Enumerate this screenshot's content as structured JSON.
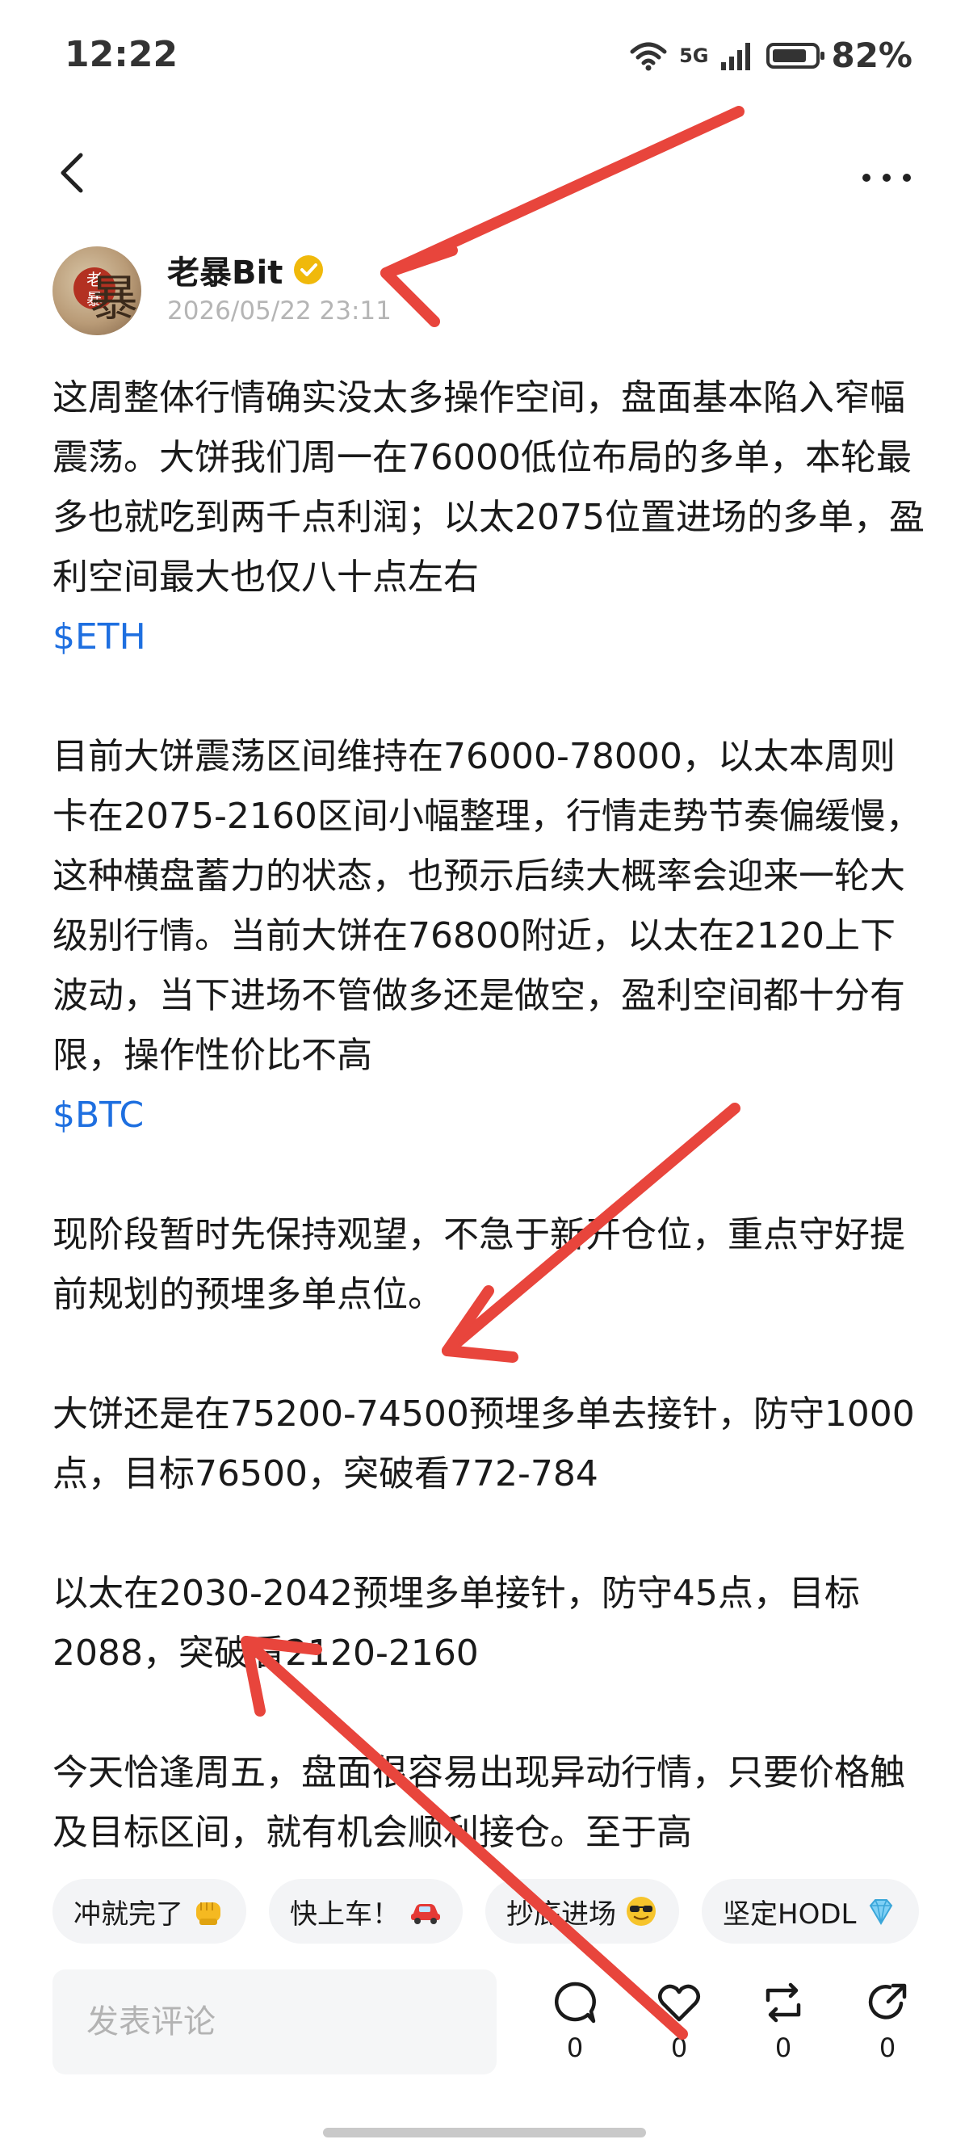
{
  "status_bar": {
    "time": "12:22",
    "network": "5G",
    "battery": "82%",
    "battery_level": 0.82
  },
  "nav": {
    "back_icon": "chevron-left-icon",
    "more_icon": "more-icon"
  },
  "author": {
    "name": "老暴Bit",
    "timestamp": "2026/05/22 23:11",
    "verified_color": "#f0b90b"
  },
  "post": {
    "paragraphs": [
      {
        "text": "这周整体行情确实没太多操作空间，盘面基本陷入窄幅震荡。大饼我们周一在76000低位布局的多单，本轮最多也就吃到两千点利润；以太2075位置进场的多单，盈利空间最大也仅八十点左右",
        "tag": "$ETH"
      },
      {
        "text": "目前大饼震荡区间维持在76000-78000，以太本周则卡在2075-2160区间小幅整理，行情走势节奏偏缓慢，这种横盘蓄力的状态，也预示后续大概率会迎来一轮大级别行情。当前大饼在76800附近，以太在2120上下波动，当下进场不管做多还是做空，盈利空间都十分有限，操作性价比不高",
        "tag": "$BTC"
      },
      {
        "text": "现阶段暂时先保持观望，不急于新开仓位，重点守好提前规划的预埋多单点位。"
      },
      {
        "text": "大饼还是在75200-74500预埋多单去接针，防守1000点，目标76500，突破看772-784"
      },
      {
        "text": "以太在2030-2042预埋多单接针，防守45点，目标2088，突破看2120-2160"
      },
      {
        "text": "今天恰逢周五，盘面很容易出现异动行情，只要价格触及目标区间，就有机会顺利接仓。至于高"
      }
    ],
    "tag_color": "#1e6fe0"
  },
  "reactions": [
    {
      "label": "冲就完了",
      "emoji": "punch-icon"
    },
    {
      "label": "快上车！",
      "emoji": "car-icon"
    },
    {
      "label": "抄底进场",
      "emoji": "sunglasses-icon"
    },
    {
      "label": "坚定HODL",
      "emoji": "diamond-icon"
    }
  ],
  "bottom_bar": {
    "comment_placeholder": "发表评论",
    "comment_count": "0",
    "like_count": "0",
    "repost_count": "0",
    "share_count": "0"
  },
  "annotation_color": "#e8453c"
}
